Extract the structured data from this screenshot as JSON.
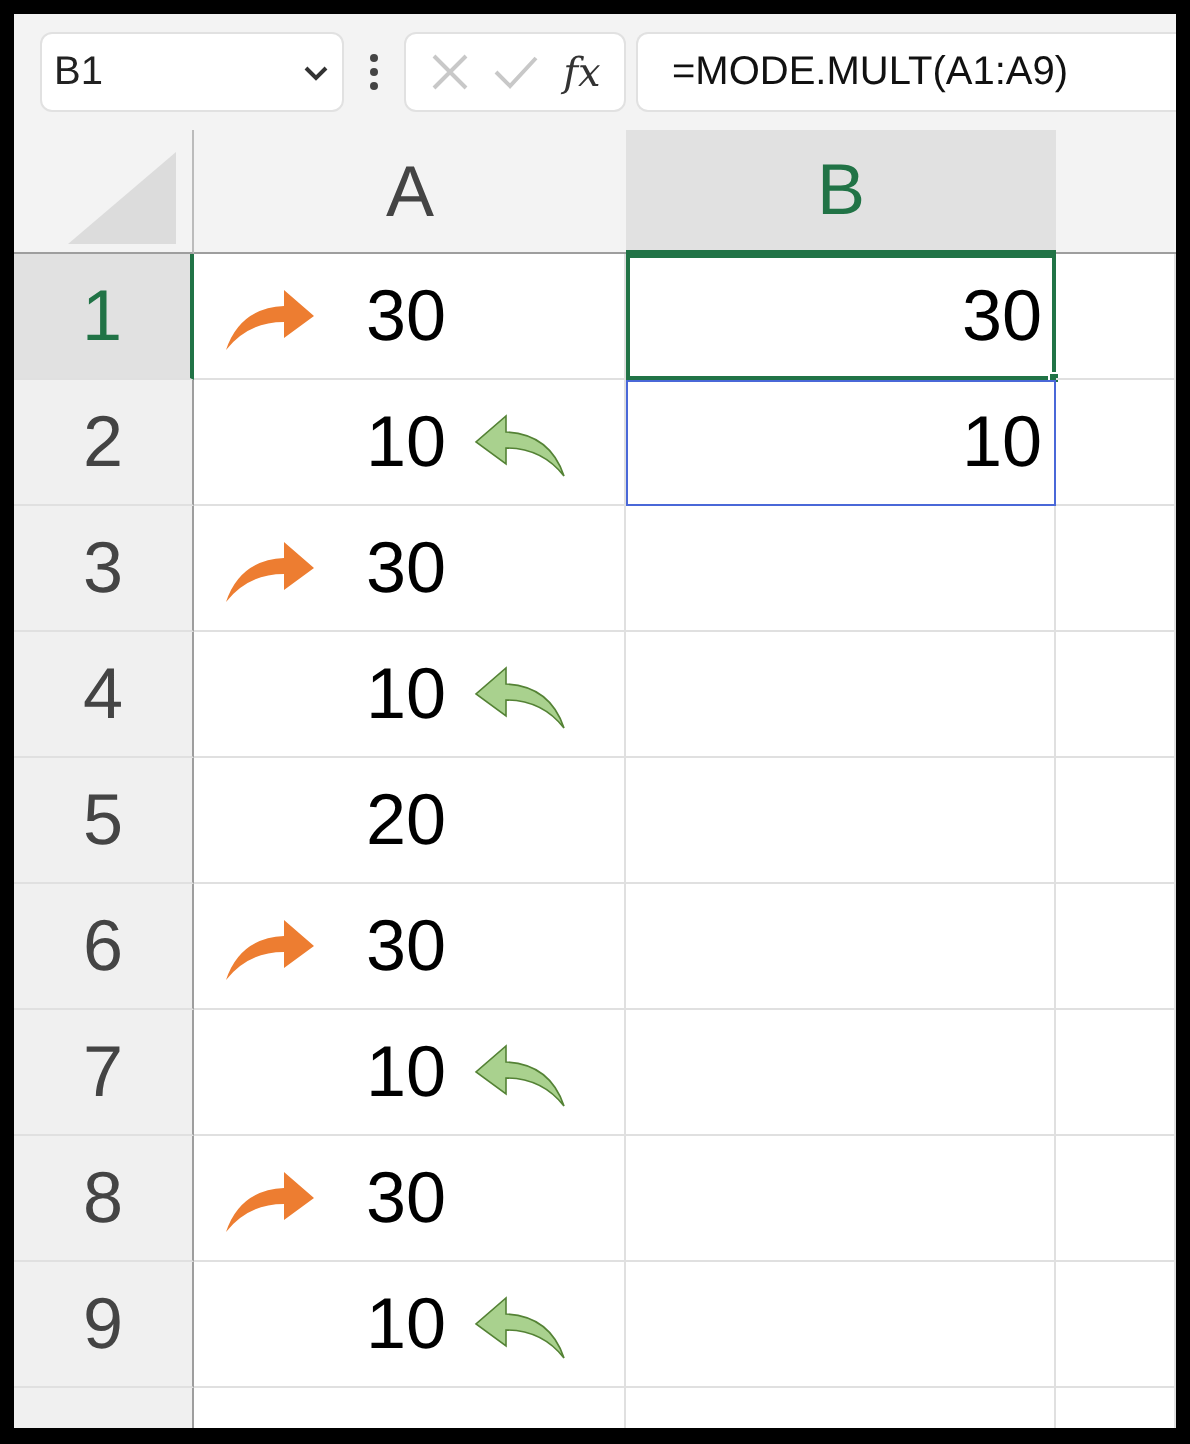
{
  "name_box": "B1",
  "fx_label": "fx",
  "formula": "=MODE.MULT(A1:A9)",
  "columns": [
    {
      "label": "A",
      "selected": false
    },
    {
      "label": "B",
      "selected": true
    }
  ],
  "rows": [
    {
      "number": "1",
      "selected": true,
      "a": "30",
      "arrow_before": true,
      "arrow_after": false,
      "b": "30",
      "active": true,
      "in_spill_range": true
    },
    {
      "number": "2",
      "selected": false,
      "a": "10",
      "arrow_before": false,
      "arrow_after": true,
      "b": "10",
      "active": false,
      "in_spill_range": true
    },
    {
      "number": "3",
      "selected": false,
      "a": "30",
      "arrow_before": true,
      "arrow_after": false
    },
    {
      "number": "4",
      "selected": false,
      "a": "10",
      "arrow_before": false,
      "arrow_after": true
    },
    {
      "number": "5",
      "selected": false,
      "a": "20",
      "arrow_before": false,
      "arrow_after": false
    },
    {
      "number": "6",
      "selected": false,
      "a": "30",
      "arrow_before": true,
      "arrow_after": false
    },
    {
      "number": "7",
      "selected": false,
      "a": "10",
      "arrow_before": false,
      "arrow_after": true
    },
    {
      "number": "8",
      "selected": false,
      "a": "30",
      "arrow_before": true,
      "arrow_after": false
    },
    {
      "number": "9",
      "selected": false,
      "a": "10",
      "arrow_before": false,
      "arrow_after": true
    }
  ]
}
